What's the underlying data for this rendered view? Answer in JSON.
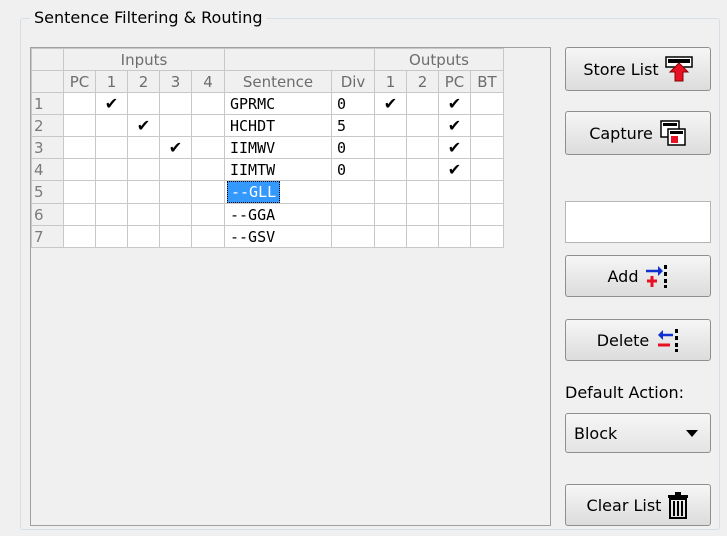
{
  "group": {
    "title": "Sentence Filtering & Routing"
  },
  "grid": {
    "group_headers": {
      "inputs": "Inputs",
      "outputs": "Outputs"
    },
    "columns": [
      "PC",
      "1",
      "2",
      "3",
      "4",
      "Sentence",
      "Div",
      "1",
      "2",
      "PC",
      "BT"
    ],
    "rows": [
      {
        "num": "1",
        "in": [
          "",
          "✔",
          "",
          "",
          ""
        ],
        "sentence": "GPRMC",
        "div": "0",
        "out": [
          "✔",
          "",
          "✔",
          ""
        ]
      },
      {
        "num": "2",
        "in": [
          "",
          "",
          "✔",
          "",
          ""
        ],
        "sentence": "HCHDT",
        "div": "5",
        "out": [
          "",
          "",
          "✔",
          ""
        ]
      },
      {
        "num": "3",
        "in": [
          "",
          "",
          "",
          "✔",
          ""
        ],
        "sentence": "IIMWV",
        "div": "0",
        "out": [
          "",
          "",
          "✔",
          ""
        ]
      },
      {
        "num": "4",
        "in": [
          "",
          "",
          "",
          "",
          ""
        ],
        "sentence": "IIMTW",
        "div": "0",
        "out": [
          "",
          "",
          "✔",
          ""
        ]
      },
      {
        "num": "5",
        "in": [
          "",
          "",
          "",
          "",
          ""
        ],
        "sentence": "--GLL",
        "div": "",
        "out": [
          "",
          "",
          "",
          ""
        ],
        "selected": true
      },
      {
        "num": "6",
        "in": [
          "",
          "",
          "",
          "",
          ""
        ],
        "sentence": "--GGA",
        "div": "",
        "out": [
          "",
          "",
          "",
          ""
        ]
      },
      {
        "num": "7",
        "in": [
          "",
          "",
          "",
          "",
          ""
        ],
        "sentence": "--GSV",
        "div": "",
        "out": [
          "",
          "",
          "",
          ""
        ]
      }
    ]
  },
  "buttons": {
    "store_list": "Store List",
    "capture": "Capture",
    "add": "Add",
    "delete": "Delete",
    "clear_list": "Clear List"
  },
  "default_action": {
    "label": "Default Action:",
    "value": "Block"
  },
  "icons": {
    "store": "store-arrow-icon",
    "capture": "capture-icon",
    "add": "add-row-icon",
    "delete": "delete-row-icon",
    "clear": "trash-icon"
  },
  "colors": {
    "selection": "#3399ff",
    "red": "#e81123",
    "blue": "#1030d0"
  }
}
